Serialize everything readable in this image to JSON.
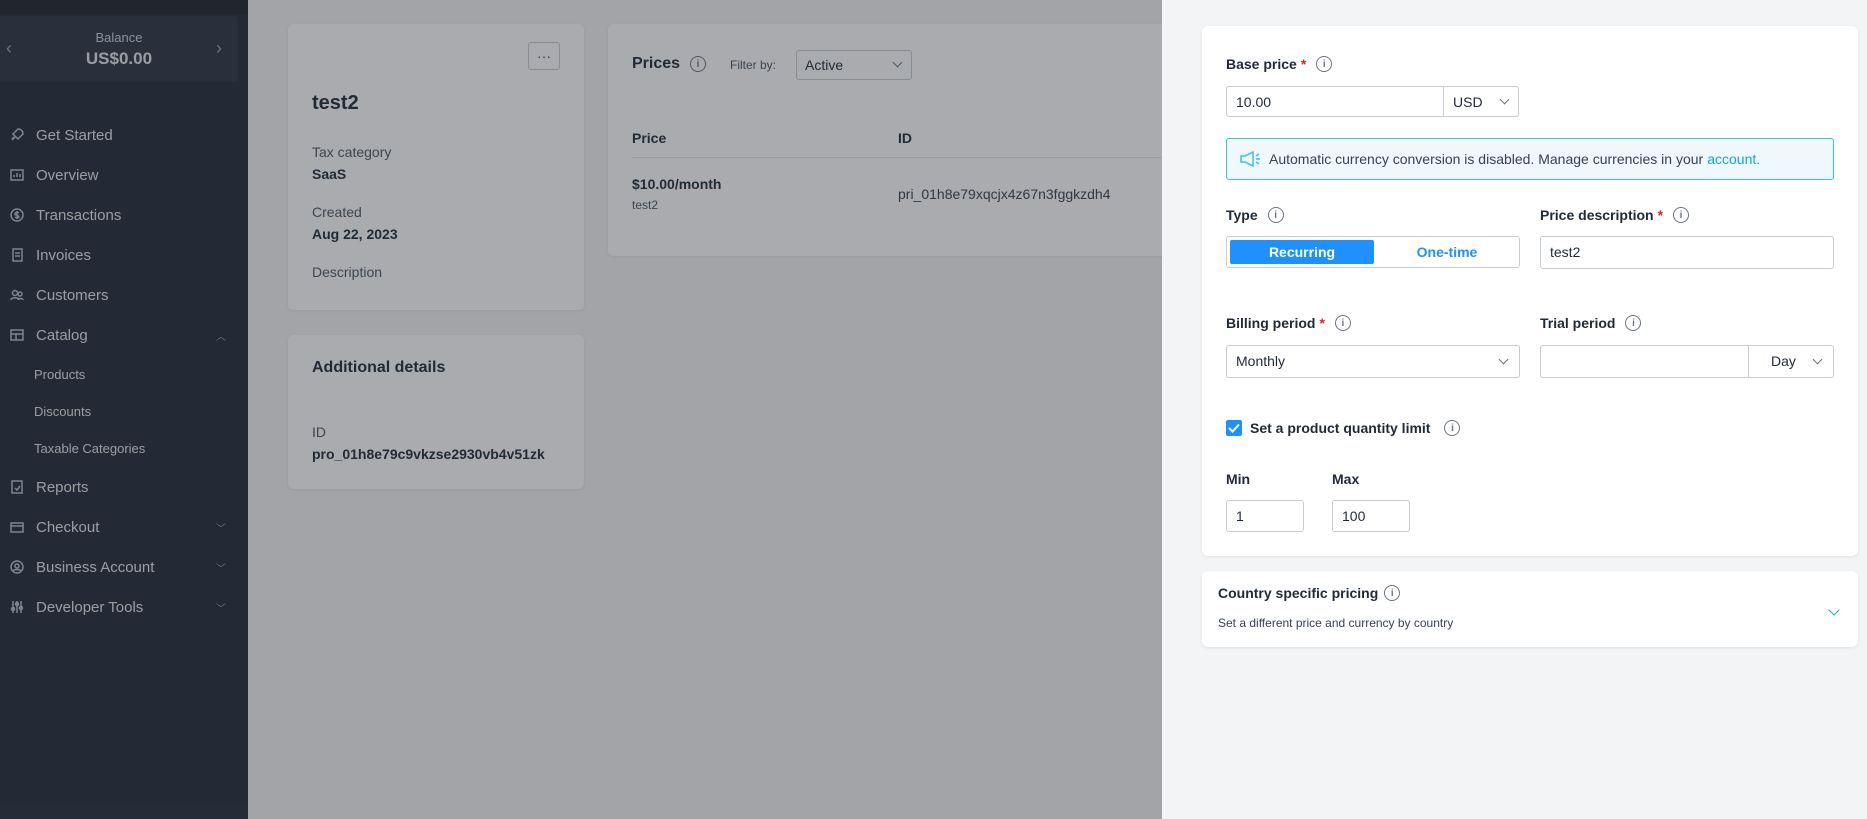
{
  "sidebar": {
    "balance_label": "Balance",
    "balance_value": "US$0.00",
    "items": [
      {
        "label": "Get Started",
        "icon": "rocket-icon"
      },
      {
        "label": "Overview",
        "icon": "chart-icon"
      },
      {
        "label": "Transactions",
        "icon": "dollar-circle-icon"
      },
      {
        "label": "Invoices",
        "icon": "document-icon"
      },
      {
        "label": "Customers",
        "icon": "users-icon"
      },
      {
        "label": "Catalog",
        "icon": "catalog-icon"
      },
      {
        "label": "Reports",
        "icon": "report-icon"
      },
      {
        "label": "Checkout",
        "icon": "card-icon"
      },
      {
        "label": "Business Account",
        "icon": "account-icon"
      },
      {
        "label": "Developer Tools",
        "icon": "tools-icon"
      }
    ],
    "catalog_sub": [
      "Products",
      "Discounts",
      "Taxable Categories"
    ]
  },
  "product": {
    "more": "···",
    "name": "test2",
    "tax_category_label": "Tax category",
    "tax_category_value": "SaaS",
    "created_label": "Created",
    "created_value": "Aug 22, 2023",
    "description_label": "Description"
  },
  "details": {
    "title": "Additional details",
    "id_label": "ID",
    "id_value": "pro_01h8e79c9vkzse2930vb4v51zk"
  },
  "prices": {
    "title": "Prices",
    "filter_label": "Filter by:",
    "filter_value": "Active",
    "col_price": "Price",
    "col_id": "ID",
    "row_price": "$10.00/month",
    "row_desc": "test2",
    "row_id": "pri_01h8e79xqcjx4z67n3fggkzdh4"
  },
  "form": {
    "base_price_label": "Base price",
    "base_price_value": "10.00",
    "currency": "USD",
    "alert_text": "Automatic currency conversion is disabled. Manage currencies in your",
    "alert_link": "account.",
    "type_label": "Type",
    "type_recurring": "Recurring",
    "type_onetime": "One-time",
    "price_desc_label": "Price description",
    "price_desc_value": "test2",
    "billing_label": "Billing period",
    "billing_value": "Monthly",
    "trial_label": "Trial period",
    "trial_value": "",
    "trial_unit": "Day",
    "qty_limit_label": "Set a product quantity limit",
    "qty_limit_checked": true,
    "min_label": "Min",
    "min_value": "1",
    "max_label": "Max",
    "max_value": "100"
  },
  "country": {
    "title": "Country specific pricing",
    "subtitle": "Set a different price and currency by country"
  },
  "colors": {
    "sidebar_bg": "#222836",
    "accent": "#1e90ff",
    "alert_border": "#38bdf8",
    "required": "#e02424"
  }
}
